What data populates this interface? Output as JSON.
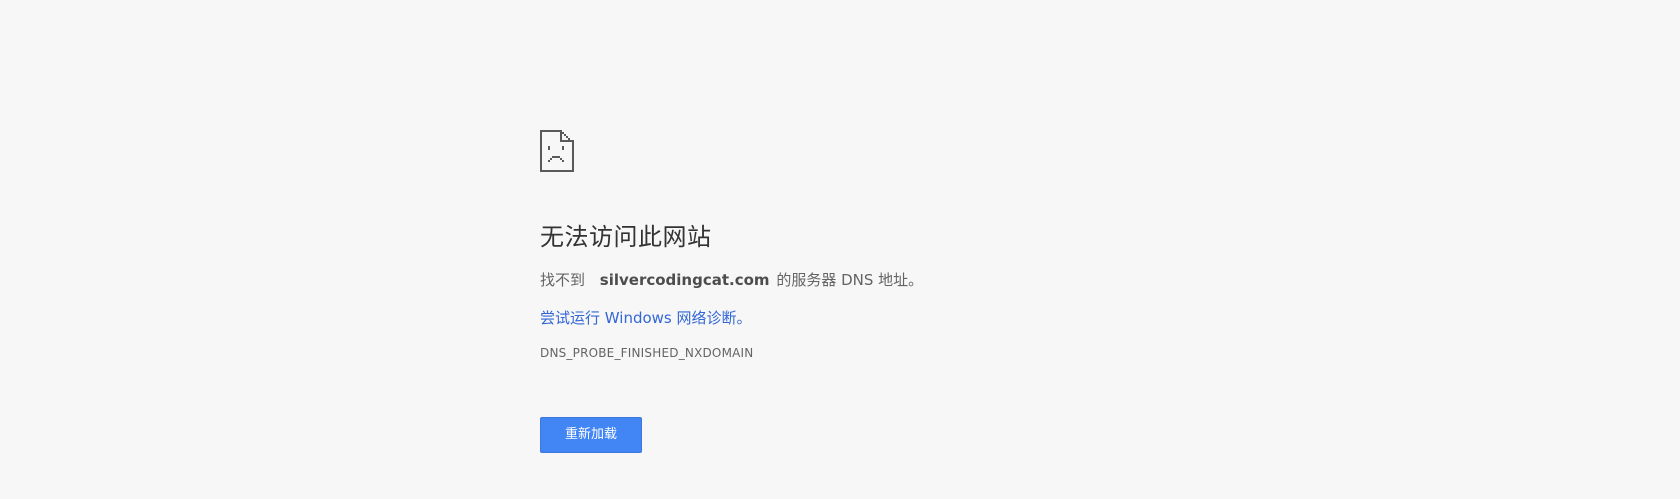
{
  "page": {
    "title": "无法访问此网站",
    "desc_prefix": "找不到",
    "host": "silvercodingcat.com",
    "desc_suffix": "的服务器 DNS 地址。",
    "diagnose_link": "尝试运行 Windows 网络诊断。",
    "error_code": "DNS_PROBE_FINISHED_NXDOMAIN",
    "reload_label": "重新加载"
  },
  "icons": {
    "main": "sad-page-icon"
  },
  "colors": {
    "background": "#f7f7f7",
    "link": "#3367d6",
    "button": "#4285f4"
  }
}
